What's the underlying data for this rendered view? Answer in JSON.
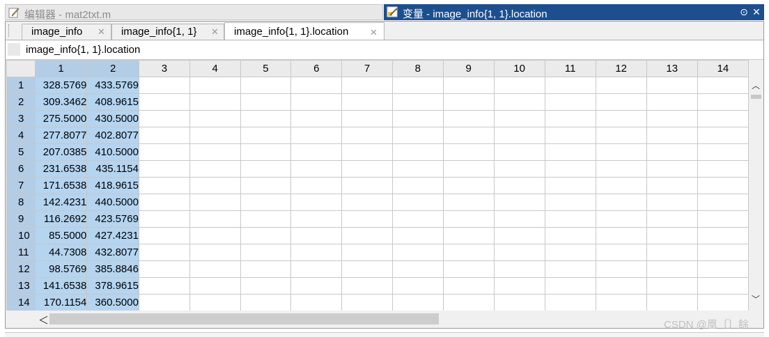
{
  "titlebar": {
    "editor_title": "编辑器 - mat2txt.m",
    "variable_title": "变量 - image_info{1, 1}.location",
    "menu_glyph": "⊙",
    "close_glyph": "✕"
  },
  "tabs": [
    {
      "label": "image_info",
      "close": "✕"
    },
    {
      "label": "image_info{1, 1}",
      "close": "✕"
    },
    {
      "label": "image_info{1, 1}.location",
      "close": "✕"
    }
  ],
  "path": "image_info{1, 1}.location",
  "grid": {
    "columns": [
      "1",
      "2",
      "3",
      "4",
      "5",
      "6",
      "7",
      "8",
      "9",
      "10",
      "11",
      "12",
      "13",
      "14"
    ],
    "rows": [
      {
        "index": "1",
        "cells": [
          "328.5769",
          "433.5769"
        ]
      },
      {
        "index": "2",
        "cells": [
          "309.3462",
          "408.9615"
        ]
      },
      {
        "index": "3",
        "cells": [
          "275.5000",
          "430.5000"
        ]
      },
      {
        "index": "4",
        "cells": [
          "277.8077",
          "402.8077"
        ]
      },
      {
        "index": "5",
        "cells": [
          "207.0385",
          "410.5000"
        ]
      },
      {
        "index": "6",
        "cells": [
          "231.6538",
          "435.1154"
        ]
      },
      {
        "index": "7",
        "cells": [
          "171.6538",
          "418.9615"
        ]
      },
      {
        "index": "8",
        "cells": [
          "142.4231",
          "440.5000"
        ]
      },
      {
        "index": "9",
        "cells": [
          "116.2692",
          "423.5769"
        ]
      },
      {
        "index": "10",
        "cells": [
          "85.5000",
          "427.4231"
        ]
      },
      {
        "index": "11",
        "cells": [
          "44.7308",
          "432.8077"
        ]
      },
      {
        "index": "12",
        "cells": [
          "98.5769",
          "385.8846"
        ]
      },
      {
        "index": "13",
        "cells": [
          "141.6538",
          "378.9615"
        ]
      },
      {
        "index": "14",
        "cells": [
          "170.1154",
          "360.5000"
        ]
      }
    ]
  },
  "scroll": {
    "up": "︿",
    "down": "﹀",
    "left": "＜"
  },
  "watermark": "CSDN @凰〔〕餘",
  "colors": {
    "title_active": "#1d4f8f",
    "selection": "#b4d4f0",
    "header_selected": "#b4cde6"
  }
}
